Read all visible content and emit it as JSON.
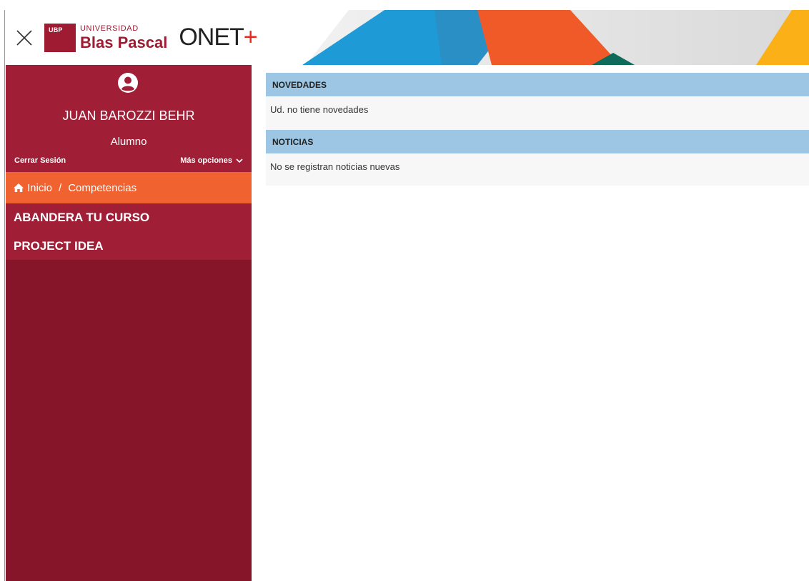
{
  "header": {
    "close_icon": "close-icon",
    "logo_box_text": "UBP",
    "logo_small": "UNIVERSIDAD",
    "logo_big": "Blas Pascal",
    "product_main": "ONET",
    "product_plus": "+",
    "colors": {
      "brand": "#9e1b32",
      "plus": "#e8291c"
    }
  },
  "user": {
    "icon": "user-circle-icon",
    "name": "JUAN BAROZZI BEHR",
    "role": "Alumno",
    "logout_label": "Cerrar Sesión",
    "more_label": "Más opciones"
  },
  "breadcrumb": {
    "home_label": "Inicio",
    "separator": "/",
    "current_label": "Competencias"
  },
  "menu": {
    "items": [
      {
        "label": "ABANDERA TU CURSO"
      },
      {
        "label": "PROJECT IDEA"
      }
    ]
  },
  "main": {
    "sections": [
      {
        "title": "NOVEDADES",
        "message": "Ud. no tiene novedades"
      },
      {
        "title": "NOTICIAS",
        "message": "No se registran noticias nuevas"
      }
    ]
  },
  "colors": {
    "sidebar": "#871529",
    "sidebar_panel": "#a01f36",
    "breadcrumb": "#f06330",
    "section_header": "#9cc6e3"
  }
}
